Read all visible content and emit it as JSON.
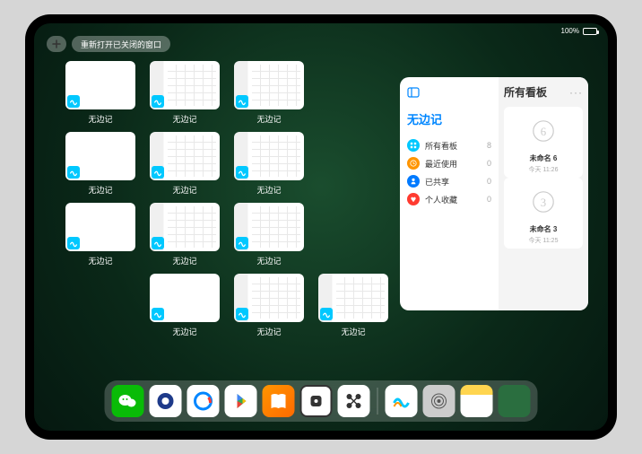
{
  "status": {
    "battery_pct": "100%"
  },
  "topbar": {
    "add_label": "+",
    "reopen_label": "重新打开已关闭的窗口"
  },
  "app_name": "无边记",
  "thumbs": [
    {
      "label": "无边记",
      "variant": "blank"
    },
    {
      "label": "无边记",
      "variant": "detailed"
    },
    {
      "label": "无边记",
      "variant": "detailed"
    },
    {
      "label": "无边记",
      "variant": "blank"
    },
    {
      "label": "无边记",
      "variant": "detailed"
    },
    {
      "label": "无边记",
      "variant": "detailed"
    },
    {
      "label": "无边记",
      "variant": "blank"
    },
    {
      "label": "无边记",
      "variant": "detailed"
    },
    {
      "label": "无边记",
      "variant": "detailed"
    },
    {
      "label": "无边记",
      "variant": "blank"
    },
    {
      "label": "无边记",
      "variant": "detailed"
    },
    {
      "label": "无边记",
      "variant": "detailed"
    }
  ],
  "panel": {
    "title": "无边记",
    "right_title": "所有看板",
    "more": "···",
    "items": [
      {
        "icon": "grid",
        "color": "#00c8ff",
        "label": "所有看板",
        "count": "8"
      },
      {
        "icon": "clock",
        "color": "#ff9500",
        "label": "最近使用",
        "count": "0"
      },
      {
        "icon": "shared",
        "color": "#007aff",
        "label": "已共享",
        "count": "0"
      },
      {
        "icon": "heart",
        "color": "#ff3b30",
        "label": "个人收藏",
        "count": "0"
      }
    ],
    "boards": [
      {
        "name": "未命名 6",
        "date": "今天 11:26",
        "numeral": "6"
      },
      {
        "name": "未命名 3",
        "date": "今天 11:25",
        "numeral": "3"
      }
    ]
  },
  "dock_icons": [
    "wechat",
    "qq-hd",
    "qq-browser",
    "play-store",
    "books",
    "game",
    "connect",
    "freeform",
    "settings",
    "notes",
    "app-library"
  ]
}
